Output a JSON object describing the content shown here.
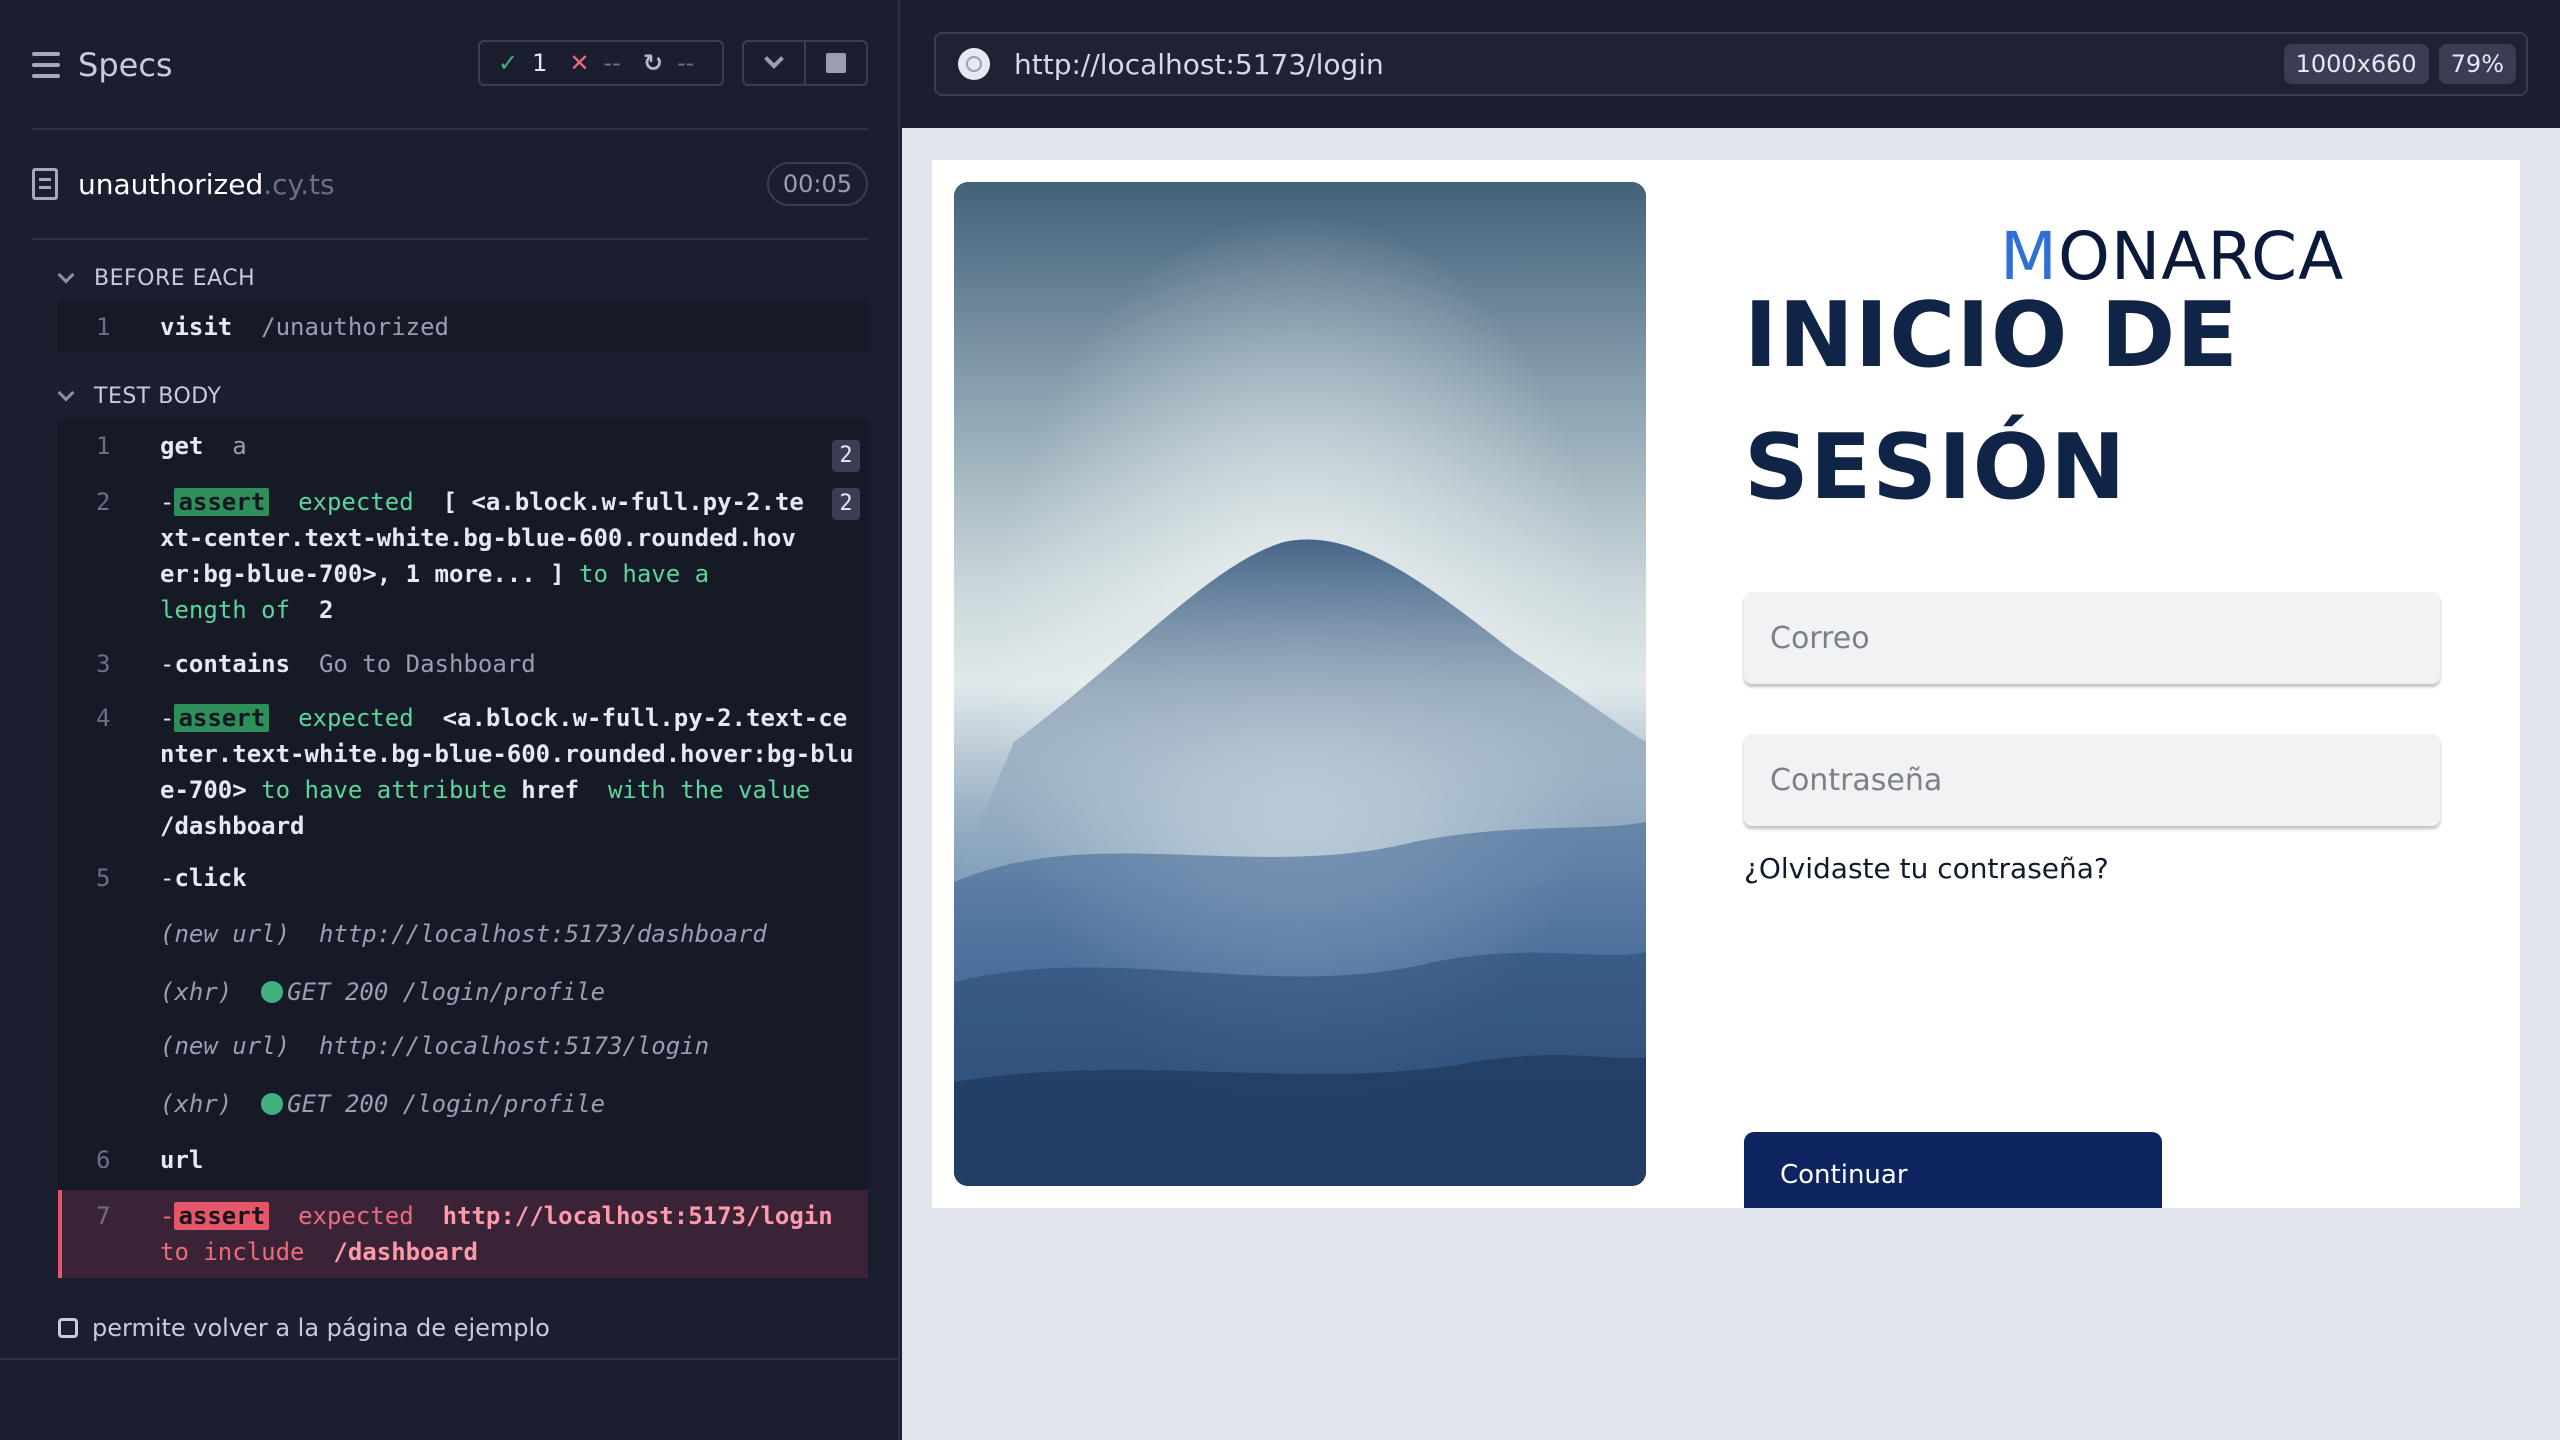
{
  "runner": {
    "specs_label": "Specs",
    "stats": {
      "passed": "1",
      "failed": "--",
      "pending": "--"
    },
    "file": {
      "name": "unauthorized",
      "ext": ".cy.ts",
      "duration": "00:05"
    },
    "before_each": {
      "label": "BEFORE EACH",
      "commands": [
        {
          "num": "1",
          "name": "visit",
          "arg": "/unauthorized"
        }
      ]
    },
    "test_body": {
      "label": "TEST BODY",
      "cmd1": {
        "num": "1",
        "name": "get",
        "arg": "a",
        "count": "2"
      },
      "cmd2": {
        "num": "2",
        "badge": "assert",
        "count": "2",
        "t1": "expected",
        "t2": "[ <a.block.w-full.py-2.text-center.text-white.bg-blue-600.rounded.hover:bg-blue-700>, 1 more... ]",
        "t3": "to have a length of",
        "t4": "2"
      },
      "cmd3": {
        "num": "3",
        "name": "contains",
        "arg": "Go to Dashboard"
      },
      "cmd4": {
        "num": "4",
        "badge": "assert",
        "t1": "expected",
        "t2": "<a.block.w-full.py-2.text-center.text-white.bg-blue-600.rounded.hover:bg-blue-700>",
        "t3": "to have attribute",
        "t4": "href",
        "t5": "with the value",
        "t6": "/dashboard"
      },
      "cmd5": {
        "num": "5",
        "name": "click"
      },
      "events": [
        {
          "type": "(new url)",
          "value": "http://localhost:5173/dashboard"
        },
        {
          "type": "(xhr)",
          "value": "GET 200 /login/profile"
        },
        {
          "type": "(new url)",
          "value": "http://localhost:5173/login"
        },
        {
          "type": "(xhr)",
          "value": "GET 200 /login/profile"
        }
      ],
      "cmd6": {
        "num": "6",
        "name": "url"
      },
      "cmd7": {
        "num": "7",
        "badge": "assert",
        "t1": "expected",
        "t2": "http://localhost:5173/login",
        "t3": "to include",
        "t4": "/dashboard"
      }
    },
    "test_title": "permite volver a la página de ejemplo"
  },
  "browser": {
    "url": "http://localhost:5173/login",
    "viewport": "1000x660",
    "zoom": "79%"
  },
  "app": {
    "logo_first": "M",
    "logo_rest": "ONARCA",
    "title_line1": "INICIO DE",
    "title_line2": "SESIÓN",
    "email_placeholder": "Correo",
    "password_placeholder": "Contraseña",
    "forgot_link": "¿Olvidaste tu contraseña?",
    "continue_button": "Continuar"
  },
  "colors": {
    "runner_bg": "#1b1e2e",
    "pass": "#3fb27f",
    "fail": "#e4576b",
    "brand_navy": "#0d2460",
    "logo_accent": "#2f6fd6"
  }
}
